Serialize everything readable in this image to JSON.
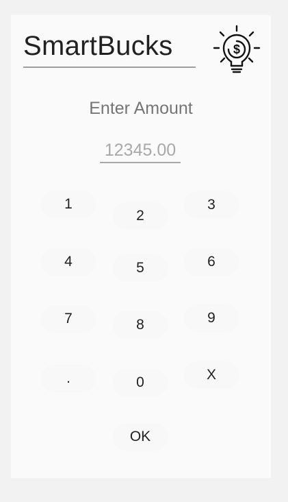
{
  "header": {
    "app_title": "SmartBucks",
    "logo_icon": "lightbulb-dollar-icon"
  },
  "amount": {
    "label": "Enter Amount",
    "placeholder": "12345.00",
    "value": ""
  },
  "keypad": {
    "k1": "1",
    "k2": "2",
    "k3": "3",
    "k4": "4",
    "k5": "5",
    "k6": "6",
    "k7": "7",
    "k8": "8",
    "k9": "9",
    "kdot": ".",
    "k0": "0",
    "kx": "X",
    "ok": "OK"
  },
  "colors": {
    "background": "#f2f2f2",
    "card": "#fafafa",
    "text_primary": "#212121",
    "text_secondary": "#757575",
    "hint": "#a8a8a8"
  }
}
